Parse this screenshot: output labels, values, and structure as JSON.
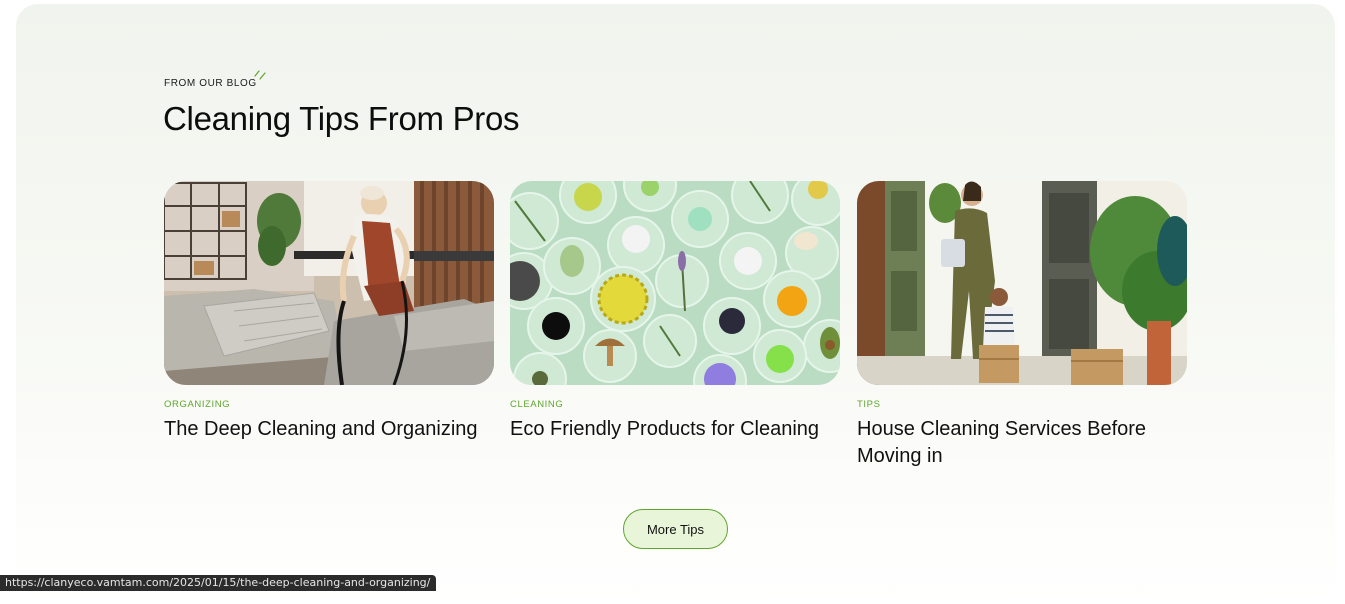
{
  "section": {
    "eyebrow": "FROM OUR BLOG",
    "title": "Cleaning Tips From Pros"
  },
  "posts": [
    {
      "category": "ORGANIZING",
      "title": "The Deep Cleaning and Organizing",
      "image": "woman vacuuming a grey sofa in a living room"
    },
    {
      "category": "CLEANING",
      "title": "Eco Friendly Products for Cleaning",
      "image": "petri dishes with natural ingredients on a mint background"
    },
    {
      "category": "TIPS",
      "title": "House Cleaning Services Before Moving in",
      "image": "mother with plant and child with moving boxes at a front door"
    }
  ],
  "more_button": {
    "label": "More Tips"
  },
  "status_bar": {
    "url": "https://clanyeco.vamtam.com/2025/01/15/the-deep-cleaning-and-organizing/"
  },
  "colors": {
    "accent_green": "#5fa52d",
    "button_fill": "#e9f5d8",
    "panel_bg": "#f3f6f0",
    "heading": "#0d0d0d"
  }
}
